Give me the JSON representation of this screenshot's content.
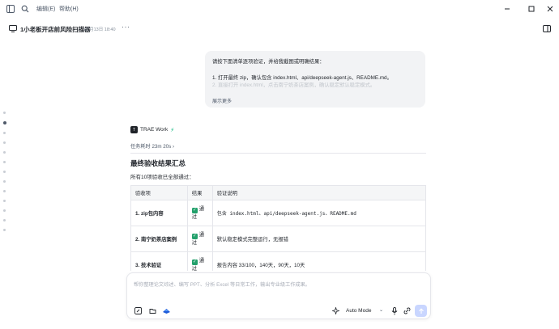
{
  "menu": {
    "edit": "编辑(E)",
    "help": "帮助(H)"
  },
  "header": {
    "title": "1小老板开店前风险扫描器",
    "time": "07月13日 18:40",
    "more": "···"
  },
  "user_message": {
    "lines": [
      "请按下面清单逐项验证，并给我截图或明确结果：",
      "",
      "1. 打开最终 zip，确认包含 index.html、api/deepseek-agent.js、README.md。",
      "2. 直接打开 index.html，点击南宁奶茶店案例，确认稳定默认稳定模式。"
    ],
    "expand": "展示更多"
  },
  "agent": {
    "logo": "T",
    "name": "TRAE Work"
  },
  "elapsed": "任务耗时 23m 20s",
  "summary": {
    "title": "最终验收结果汇总",
    "subtitle": "所有10项验收已全部通过："
  },
  "table": {
    "headers": [
      "验收项",
      "结果",
      "验证说明"
    ],
    "rows": [
      {
        "item": "1. zip包内容",
        "result": "通过",
        "note": "包含 index.html、api/deepseek-agent.js、README.md"
      },
      {
        "item": "2. 南宁奶茶店案例",
        "result": "通过",
        "note": "默认稳定模式完整运行，无报错"
      },
      {
        "item": "3. 技术验证",
        "result": "通过",
        "note": "报告内容 33/100，140天，90天，10天"
      }
    ]
  },
  "composer": {
    "placeholder": "帮你整理论文综述、编写 PPT、分析 Excel 等日常工作，输出专业级工作成果。",
    "mode": "Auto Mode"
  }
}
